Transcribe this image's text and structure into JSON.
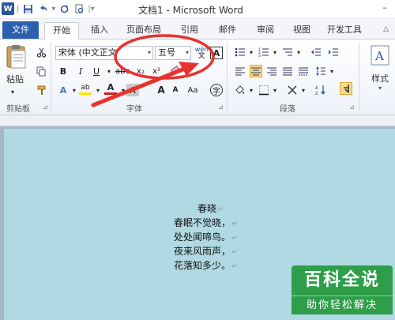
{
  "titlebar": {
    "title": "文档1 - Microsoft Word",
    "qat_icons": [
      "word-app-icon",
      "save-icon",
      "undo-icon",
      "redo-icon",
      "print-preview-icon"
    ]
  },
  "tabs": {
    "file": "文件",
    "items": [
      "开始",
      "插入",
      "页面布局",
      "引用",
      "邮件",
      "审阅",
      "视图",
      "开发工具"
    ],
    "active": "开始"
  },
  "ribbon": {
    "clipboard": {
      "paste_label": "粘贴",
      "group_label": "剪贴板"
    },
    "font": {
      "font_name": "宋体 (中文正文",
      "font_size": "五号",
      "group_label": "字体",
      "bold": "B",
      "italic": "I",
      "underline": "U",
      "strike": "abc",
      "subscript": "x₂",
      "superscript": "x²",
      "grow": "A",
      "shrink": "A",
      "phonetic": "wén",
      "border_char": "A",
      "effects": "A",
      "highlight": "ab",
      "font_color": "A",
      "char_shading": "A",
      "case": "Aa",
      "enclose": "字"
    },
    "paragraph": {
      "group_label": "段落"
    },
    "styles": {
      "label": "样式"
    }
  },
  "document": {
    "lines": [
      "春晓",
      "春眠不觉晓，",
      "处处闻啼鸟。",
      "夜来风雨声，",
      "花落知多少。"
    ],
    "paragraph_mark": "↵"
  },
  "watermark": {
    "top": "百科全说",
    "bottom": "助你轻松解决"
  },
  "colors": {
    "file_tab": "#2b5fb0",
    "page_bg": "#b1d9e3",
    "annotation": "#e8322f",
    "watermark": "#2e9e4a"
  }
}
